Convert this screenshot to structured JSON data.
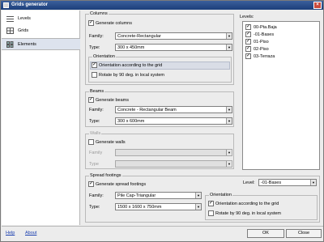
{
  "window": {
    "title": "Grids generator"
  },
  "nav": {
    "items": [
      {
        "label": "Levels",
        "icon": "levels-icon"
      },
      {
        "label": "Grids",
        "icon": "grids-icon"
      },
      {
        "label": "Elements",
        "icon": "elements-icon",
        "active": true
      }
    ]
  },
  "columns": {
    "title": "Columns",
    "generate_label": "Generate columns",
    "family_label": "Family:",
    "family_value": "Concrete-Rectangular",
    "type_label": "Type:",
    "type_value": "300 x 450mm",
    "orientation": {
      "title": "Orientation",
      "according_label": "Orientation according to the grid",
      "rotate_label": "Rotate by 90 deg. in local system"
    }
  },
  "beams": {
    "title": "Beams",
    "generate_label": "Generate beams",
    "family_label": "Family:",
    "family_value": "Concrete - Rectangular Beam",
    "type_label": "Type:",
    "type_value": "300 x 600mm"
  },
  "walls": {
    "title": "Walls",
    "generate_label": "Generate walls",
    "family_label": "Family",
    "type_label": "Type"
  },
  "levels": {
    "title": "Levels:",
    "items": [
      "00-Pta.Baja",
      "-01-Bases",
      "01-Piso",
      "02-Piso",
      "03-Terraza"
    ]
  },
  "footings": {
    "title": "Spread footings",
    "generate_label": "Generate spread footings",
    "family_label": "Family:",
    "family_value": "Pile Cap-Triangular",
    "type_label": "Type:",
    "type_value": "1500 x 1600 x 750mm",
    "level_label": "Level:",
    "level_value": "-01-Bases",
    "orientation": {
      "title": "Orientation",
      "according_label": "Orientation according to the grid",
      "rotate_label": "Rotate by 90 deg. in local system"
    }
  },
  "footer": {
    "help": "Help",
    "about": "About",
    "ok": "OK",
    "close": "Close"
  },
  "colors": {
    "titlebar": "#1d3f7a",
    "accent": "#dde3ee",
    "link": "#1a3fb0"
  }
}
